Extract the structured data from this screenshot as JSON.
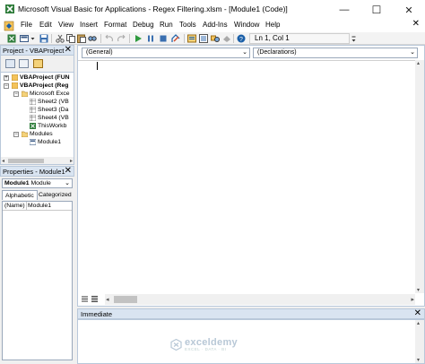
{
  "window": {
    "title": "Microsoft Visual Basic for Applications - Regex Filtering.xlsm - [Module1 (Code)]",
    "minimize": "—",
    "maximize": "☐",
    "close": "✕"
  },
  "menu": {
    "items": [
      "File",
      "Edit",
      "View",
      "Insert",
      "Format",
      "Debug",
      "Run",
      "Tools",
      "Add-Ins",
      "Window",
      "Help"
    ],
    "close": "✕"
  },
  "toolbar": {
    "position": "Ln 1, Col 1"
  },
  "project": {
    "header": "Project - VBAProject",
    "close": "✕",
    "tree": [
      {
        "label": "VBAProject (FUN",
        "indent": 0,
        "bold": true,
        "expander": "+"
      },
      {
        "label": "VBAProject (Reg",
        "indent": 0,
        "bold": true,
        "expander": "−"
      },
      {
        "label": "Microsoft Exce",
        "indent": 1,
        "bold": false,
        "expander": "−"
      },
      {
        "label": "Sheet2 (VB",
        "indent": 2,
        "bold": false,
        "expander": ""
      },
      {
        "label": "Sheet3 (Da",
        "indent": 2,
        "bold": false,
        "expander": ""
      },
      {
        "label": "Sheet4 (VB",
        "indent": 2,
        "bold": false,
        "expander": ""
      },
      {
        "label": "ThisWorkb",
        "indent": 2,
        "bold": false,
        "expander": ""
      },
      {
        "label": "Modules",
        "indent": 1,
        "bold": false,
        "expander": "−"
      },
      {
        "label": "Module1",
        "indent": 2,
        "bold": false,
        "expander": ""
      }
    ]
  },
  "properties": {
    "header": "Properties - Module1",
    "close": "✕",
    "object_name": "Module1",
    "object_type": "Module",
    "tabs": [
      "Alphabetic",
      "Categorized"
    ],
    "row": {
      "name": "(Name)",
      "value": "Module1"
    }
  },
  "code": {
    "object_combo": "(General)",
    "procedure_combo": "(Declarations)"
  },
  "immediate": {
    "header": "Immediate",
    "close": "✕"
  },
  "watermark": {
    "name": "exceldemy",
    "tagline": "EXCEL · DATA · BI"
  },
  "colors": {
    "pane_header": "#d9e4f1",
    "accent": "#1a5fa8"
  }
}
